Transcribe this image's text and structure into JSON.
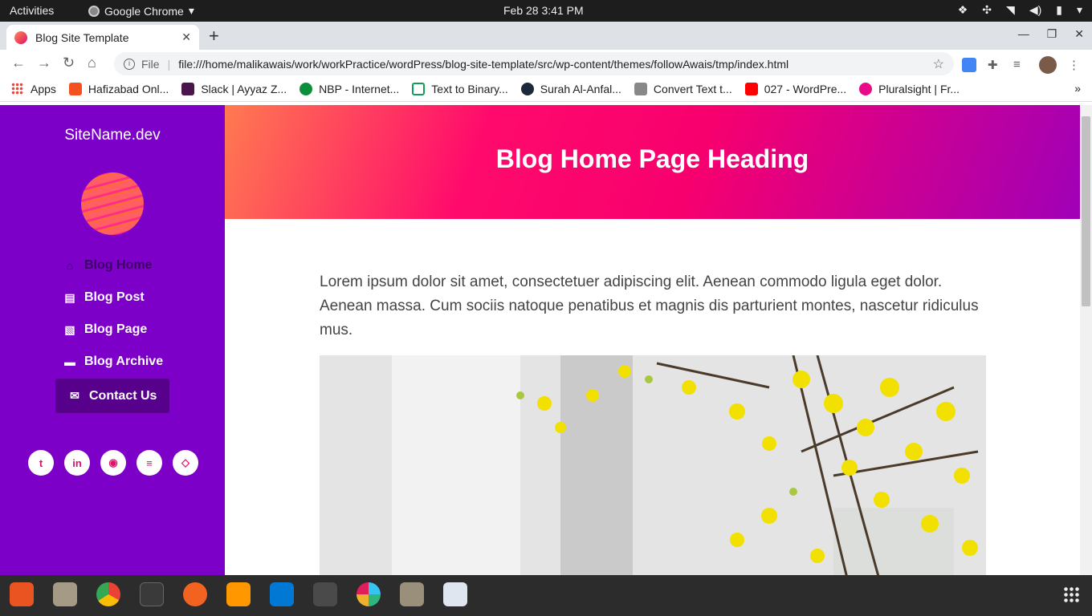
{
  "system": {
    "activities": "Activities",
    "app_name": "Google Chrome",
    "clock": "Feb 28   3:41 PM"
  },
  "browser": {
    "tab_title": "Blog Site Template",
    "new_tab": "+",
    "scheme_label": "File",
    "url": "file:///home/malikawais/work/workPractice/wordPress/blog-site-template/src/wp-content/themes/followAwais/tmp/index.html",
    "bookmarks": [
      {
        "label": "Apps",
        "color": "#e8453c"
      },
      {
        "label": "Hafizabad Onl...",
        "color": "#f4511e"
      },
      {
        "label": "Slack | Ayyaz Z...",
        "color": "#4a154b"
      },
      {
        "label": "NBP - Internet...",
        "color": "#0a8f3c"
      },
      {
        "label": "Text to Binary...",
        "color": "#0f9d58"
      },
      {
        "label": "Surah Al-Anfal...",
        "color": "#1a2a3a"
      },
      {
        "label": "Convert Text t...",
        "color": "#888888"
      },
      {
        "label": "027 - WordPre...",
        "color": "#ff0000"
      },
      {
        "label": "Pluralsight | Fr...",
        "color": "#e80a89"
      }
    ],
    "bookmarks_more": "»"
  },
  "site": {
    "name": "SiteName.dev",
    "heading": "Blog Home Page Heading",
    "nav": [
      {
        "label": "Blog Home",
        "icon": "home-icon"
      },
      {
        "label": "Blog Post",
        "icon": "file-icon"
      },
      {
        "label": "Blog Page",
        "icon": "file-image-icon"
      },
      {
        "label": "Blog Archive",
        "icon": "archive-icon"
      },
      {
        "label": "Contact Us",
        "icon": "envelope-icon"
      }
    ],
    "social": [
      "twitter-icon",
      "linkedin-icon",
      "github-icon",
      "stackoverflow-icon",
      "codepen-icon"
    ],
    "body": "Lorem ipsum dolor sit amet, consectetuer adipiscing elit. Aenean commodo ligula eget dolor. Aenean massa. Cum sociis natoque penatibus et magnis dis parturient montes, nascetur ridiculus mus.",
    "colors": {
      "sidebar": "#7d00c8",
      "hero_start": "#ff7a50",
      "hero_mid": "#ff0a6c",
      "hero_end": "#a000b8",
      "accent": "#e0106a"
    }
  }
}
